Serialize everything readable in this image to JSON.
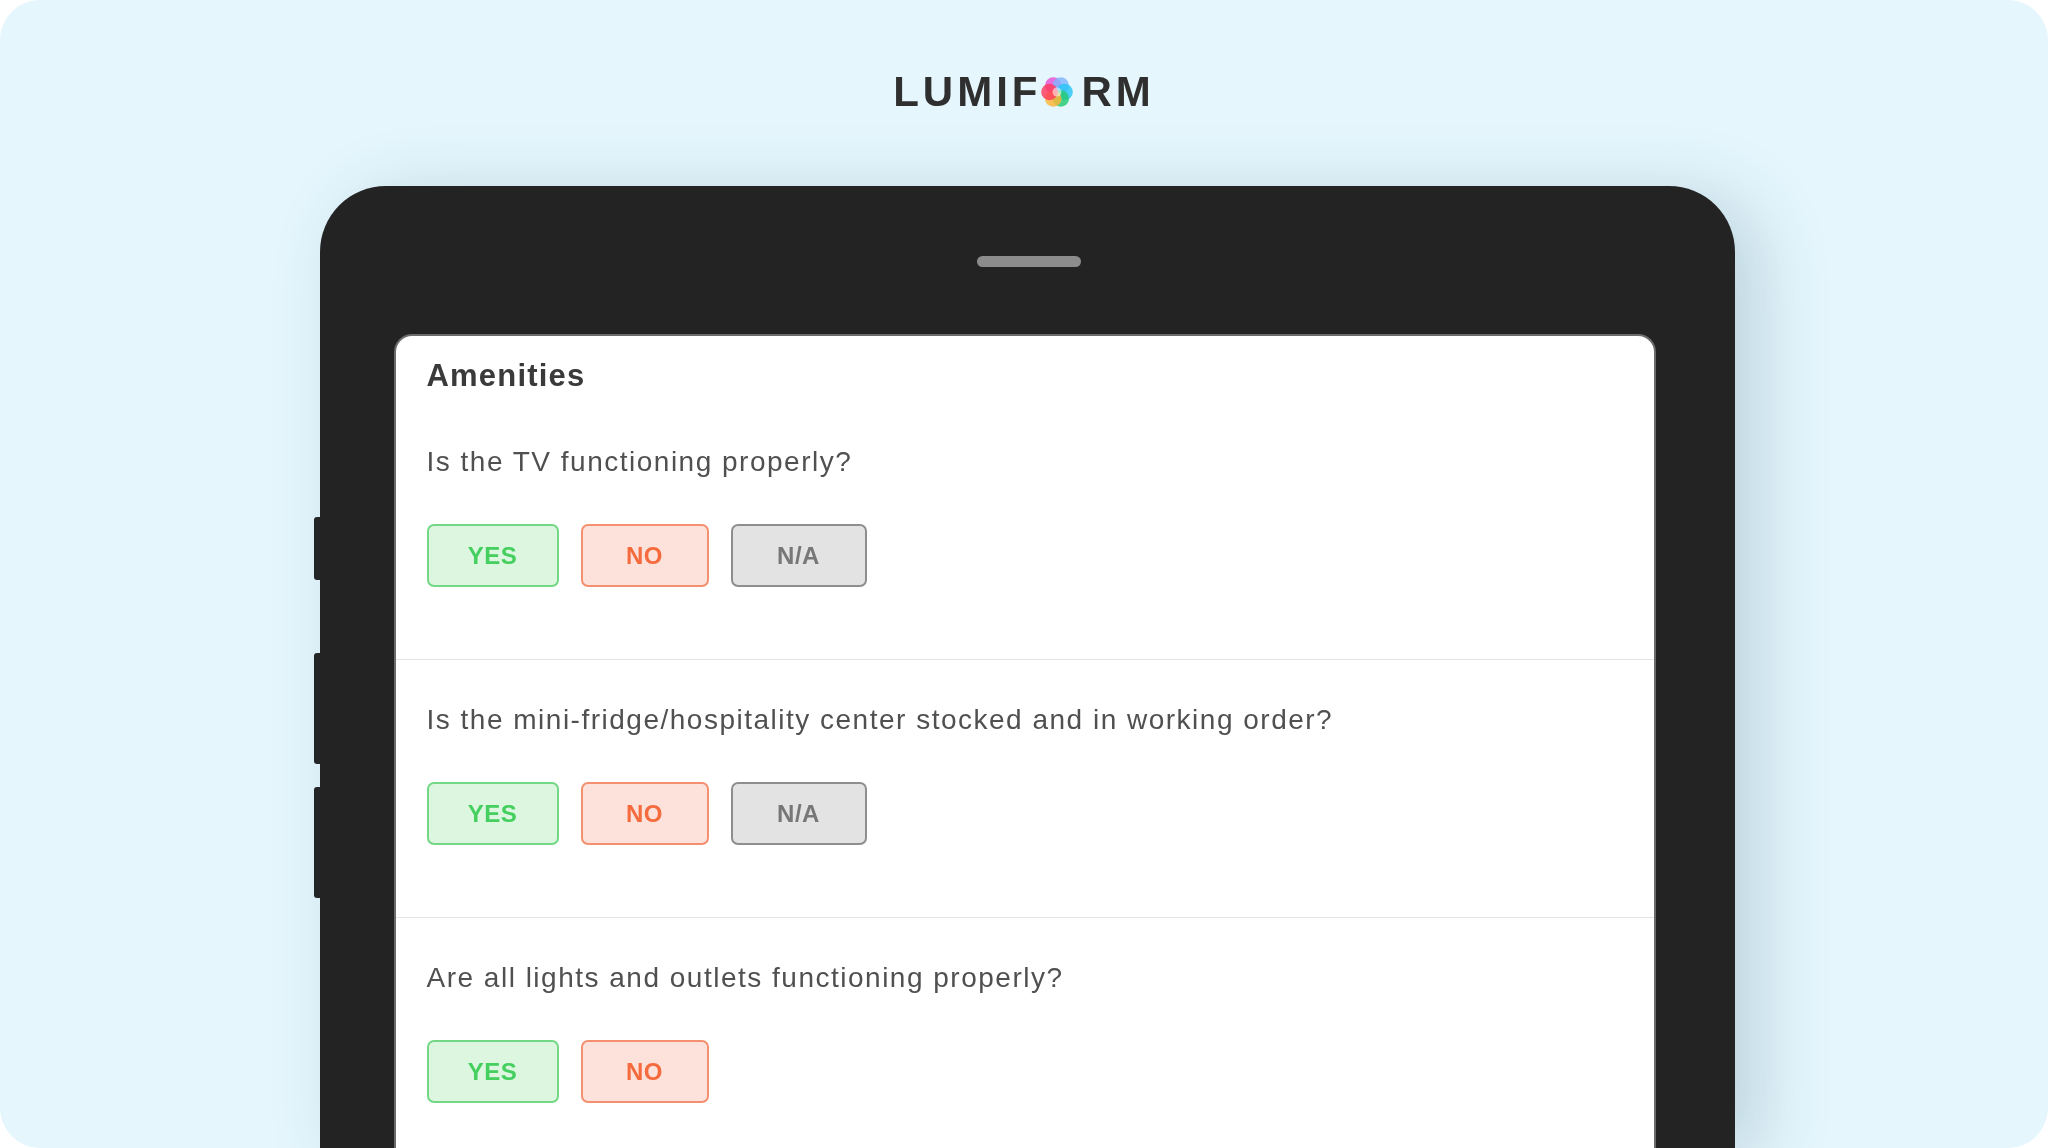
{
  "logo": {
    "text_before_icon": "LUMIF",
    "text_after_icon": "RM"
  },
  "section": {
    "title": "Amenities",
    "questions": [
      {
        "text": "Is the TV functioning properly?",
        "options": [
          {
            "label": "YES",
            "kind": "yes",
            "selected": false
          },
          {
            "label": "NO",
            "kind": "no",
            "selected": false
          },
          {
            "label": "N/A",
            "kind": "na",
            "selected": false
          }
        ]
      },
      {
        "text": "Is the mini-fridge/hospitality center stocked and in working order?",
        "options": [
          {
            "label": "YES",
            "kind": "yes",
            "selected": false
          },
          {
            "label": "NO",
            "kind": "no",
            "selected": false
          },
          {
            "label": "N/A",
            "kind": "na",
            "selected": false
          }
        ]
      },
      {
        "text": "Are all lights and outlets functioning properly?",
        "options": [
          {
            "label": "YES",
            "kind": "yes",
            "selected": false
          },
          {
            "label": "NO",
            "kind": "no",
            "selected": false
          }
        ]
      }
    ]
  }
}
